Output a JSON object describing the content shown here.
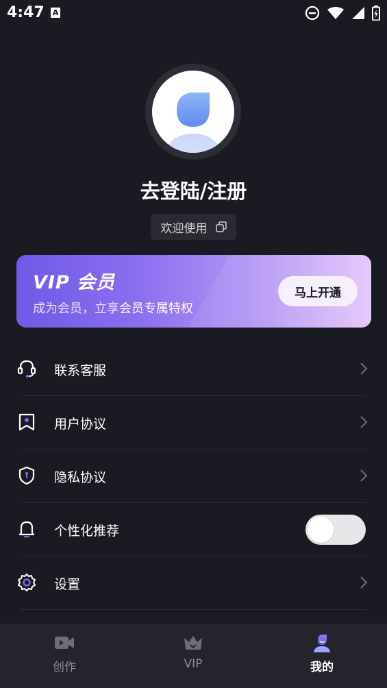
{
  "status_bar": {
    "time": "4:47",
    "notification_icon": "A"
  },
  "profile": {
    "title": "去登陆/注册",
    "welcome": "欢迎使用"
  },
  "vip": {
    "title": "VIP 会员",
    "subtitle_prefix": "成为会员，立享",
    "subtitle_highlight": "会员专属特权",
    "button": "马上开通"
  },
  "menu": [
    {
      "label": "联系客服",
      "icon": "headset-icon"
    },
    {
      "label": "用户协议",
      "icon": "bookmark-icon"
    },
    {
      "label": "隐私协议",
      "icon": "shield-icon"
    },
    {
      "label": "个性化推荐",
      "icon": "bell-icon",
      "toggle": false
    },
    {
      "label": "设置",
      "icon": "gear-icon"
    }
  ],
  "tabs": [
    {
      "label": "创作",
      "icon": "video-camera-icon",
      "active": false
    },
    {
      "label": "VIP",
      "icon": "crown-icon",
      "active": false
    },
    {
      "label": "我的",
      "icon": "user-icon",
      "active": true
    }
  ],
  "colors": {
    "background": "#1a1a22",
    "vip_gradient_start": "#6f5ae6",
    "vip_gradient_end": "#e4c6fb",
    "accent": "#7b6cf6"
  }
}
